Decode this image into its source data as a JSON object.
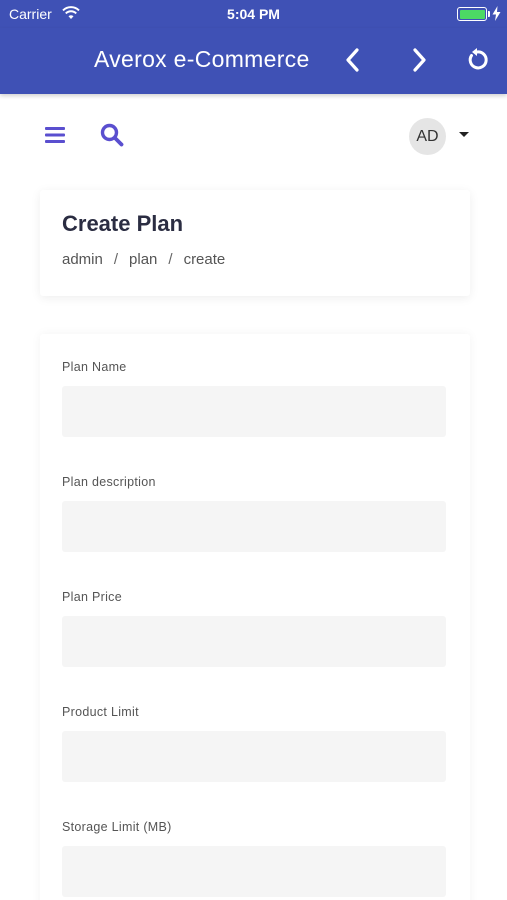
{
  "status_bar": {
    "carrier": "Carrier",
    "time": "5:04 PM",
    "battery_level": 1.0
  },
  "app_bar": {
    "title": "Averox e-Commerce",
    "color": "#3f51b5"
  },
  "toolbar": {
    "menu_icon": "hamburger-menu-icon",
    "search_icon": "search-icon",
    "avatar_initials": "AD",
    "accent_color": "#5a4fcf"
  },
  "header": {
    "title": "Create Plan",
    "breadcrumb": [
      "admin",
      "plan",
      "create"
    ],
    "separator": "/"
  },
  "form": {
    "fields": [
      {
        "label": "Plan Name",
        "value": "",
        "placeholder": ""
      },
      {
        "label": "Plan description",
        "value": "",
        "placeholder": ""
      },
      {
        "label": "Plan Price",
        "value": "",
        "placeholder": ""
      },
      {
        "label": "Product Limit",
        "value": "",
        "placeholder": ""
      },
      {
        "label": "Storage Limit (MB)",
        "value": "",
        "placeholder": ""
      }
    ]
  }
}
